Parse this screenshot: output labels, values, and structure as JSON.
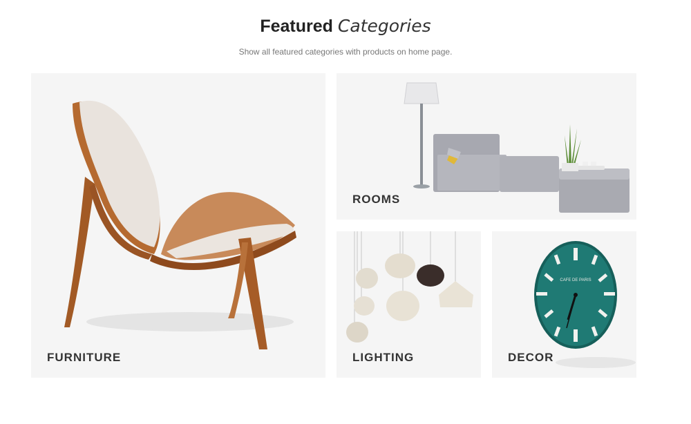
{
  "header": {
    "title_bold": "Featured",
    "title_light": "Categories",
    "subtitle": "Show all featured categories with products on home page."
  },
  "categories": [
    {
      "label": "FURNITURE",
      "image": "wooden-lounge-chair"
    },
    {
      "label": "ROOMS",
      "image": "gray-sectional-sofa-with-floor-lamp"
    },
    {
      "label": "LIGHTING",
      "image": "hanging-pendant-lamps"
    },
    {
      "label": "DECOR",
      "image": "teal-wall-clock"
    }
  ],
  "decor_clock_text": "CAFE DE PARIS",
  "colors": {
    "card_bg": "#f5f5f5",
    "title": "#222222",
    "subtitle": "#777777",
    "clock_face": "#1f7a74"
  }
}
